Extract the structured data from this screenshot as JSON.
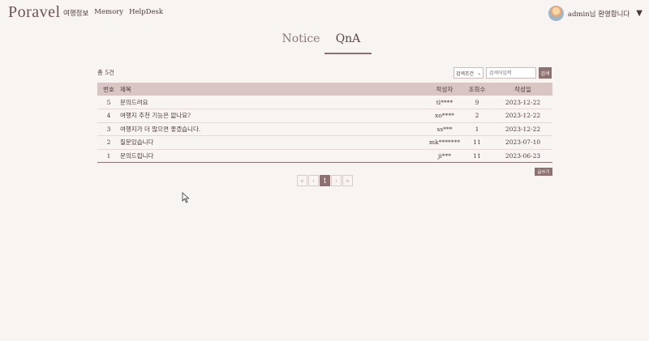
{
  "header": {
    "logo": "Poravel",
    "nav": [
      "여행정보",
      "Memory",
      "HelpDesk"
    ],
    "user_text": "admin님 환영합니다",
    "caret": "▼"
  },
  "tabs": [
    {
      "label": "Notice",
      "active": false
    },
    {
      "label": "QnA",
      "active": true
    }
  ],
  "board": {
    "count_text": "총 5건",
    "search_select": "검색조건",
    "search_placeholder": "검색어입력",
    "search_button": "검색",
    "write_button": "글쓰기",
    "columns": [
      "번호",
      "제목",
      "작성자",
      "조회수",
      "작성일"
    ],
    "rows": [
      {
        "no": "5",
        "title": "문의드려요",
        "author": "tl****",
        "views": "9",
        "date": "2023-12-22"
      },
      {
        "no": "4",
        "title": "여행지 추천 기능은 없나요?",
        "author": "xo****",
        "views": "2",
        "date": "2023-12-22"
      },
      {
        "no": "3",
        "title": "여행지가 더 많으면 좋겠습니다.",
        "author": "ss***",
        "views": "1",
        "date": "2023-12-22"
      },
      {
        "no": "2",
        "title": "질문있습니다",
        "author": "mk*******",
        "views": "11",
        "date": "2023-07-10"
      },
      {
        "no": "1",
        "title": "문의드립니다",
        "author": "ji***",
        "views": "11",
        "date": "2023-06-23"
      }
    ]
  },
  "pagination": {
    "first": "«",
    "prev": "‹",
    "current": "1",
    "next": "›",
    "last": "»"
  }
}
